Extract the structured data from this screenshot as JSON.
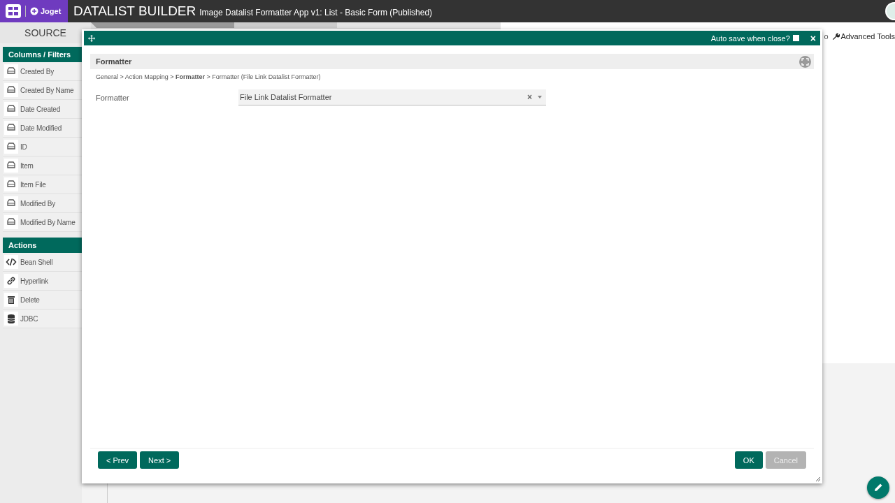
{
  "header": {
    "logo": "Joget",
    "title": "DATALIST BUILDER",
    "subtitle": "Image Datalist Formatter App v1: List - Basic Form (Published)"
  },
  "tabs": [
    {
      "label": "SOURCE",
      "selected": true
    }
  ],
  "toolbar": {
    "cut_text": "o",
    "advanced_tools": "Advanced Tools"
  },
  "palette": [
    {
      "title": "Columns / Filters",
      "items": [
        {
          "label": "Created By",
          "kind": "column"
        },
        {
          "label": "Created By Name",
          "kind": "column"
        },
        {
          "label": "Date Created",
          "kind": "column"
        },
        {
          "label": "Date Modified",
          "kind": "column"
        },
        {
          "label": "ID",
          "kind": "column"
        },
        {
          "label": "Item",
          "kind": "column"
        },
        {
          "label": "Item File",
          "kind": "column"
        },
        {
          "label": "Modified By",
          "kind": "column"
        },
        {
          "label": "Modified By Name",
          "kind": "column"
        }
      ]
    },
    {
      "title": "Actions",
      "items": [
        {
          "label": "Bean Shell",
          "kind": "code"
        },
        {
          "label": "Hyperlink",
          "kind": "link"
        },
        {
          "label": "Delete",
          "kind": "delete"
        },
        {
          "label": "JDBC",
          "kind": "database"
        }
      ]
    }
  ],
  "dialog": {
    "auto_save": {
      "label": "Auto save when close?",
      "checked": false
    },
    "close": "×",
    "section_title": "Formatter",
    "breadcrumb": "General > Action Mapping > **Formatter** > Formatter (File Link Datalist Formatter)",
    "fields": [
      {
        "label": "Formatter",
        "value": "File Link Datalist Formatter",
        "clear": "×"
      }
    ],
    "nav_buttons": [
      {
        "label": "< Prev",
        "disabled": false
      },
      {
        "label": "Next >",
        "disabled": false
      }
    ],
    "buttons": [
      {
        "label": "OK",
        "disabled": false
      },
      {
        "label": "Cancel",
        "disabled": true
      }
    ]
  }
}
